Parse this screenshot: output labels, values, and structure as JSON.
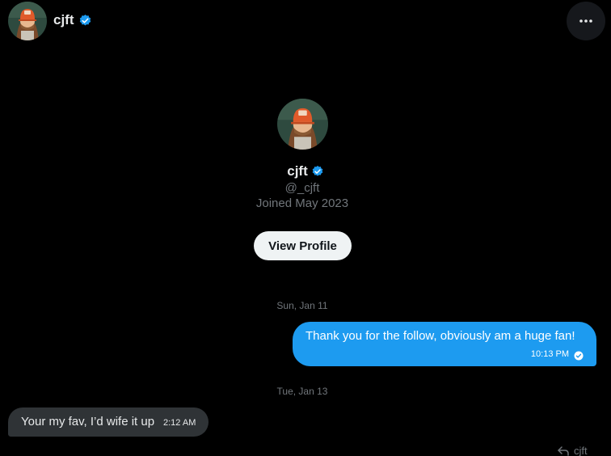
{
  "header": {
    "name": "cjft",
    "verified_icon": "verified-badge-icon",
    "more_icon": "more-horizontal-icon"
  },
  "profile": {
    "name": "cjft",
    "handle": "@_cjft",
    "joined": "Joined May 2023",
    "view_profile_label": "View Profile"
  },
  "messages": [
    {
      "date": "Sun, Jan 11",
      "direction": "sent",
      "text": "Thank you for the follow, obviously am a huge fan!",
      "time": "10:13 PM",
      "status_icon": "read-check-icon"
    },
    {
      "date": "Tue, Jan 13",
      "direction": "received",
      "text": "Your my fav, I’d wife it up",
      "time": "2:12 AM"
    }
  ],
  "reply_hint": {
    "icon": "reply-arrow-icon",
    "text": "cjft"
  },
  "colors": {
    "background": "#000000",
    "accent": "#1d9bf0",
    "received_bubble": "#2f3336",
    "muted_text": "#71767b"
  }
}
